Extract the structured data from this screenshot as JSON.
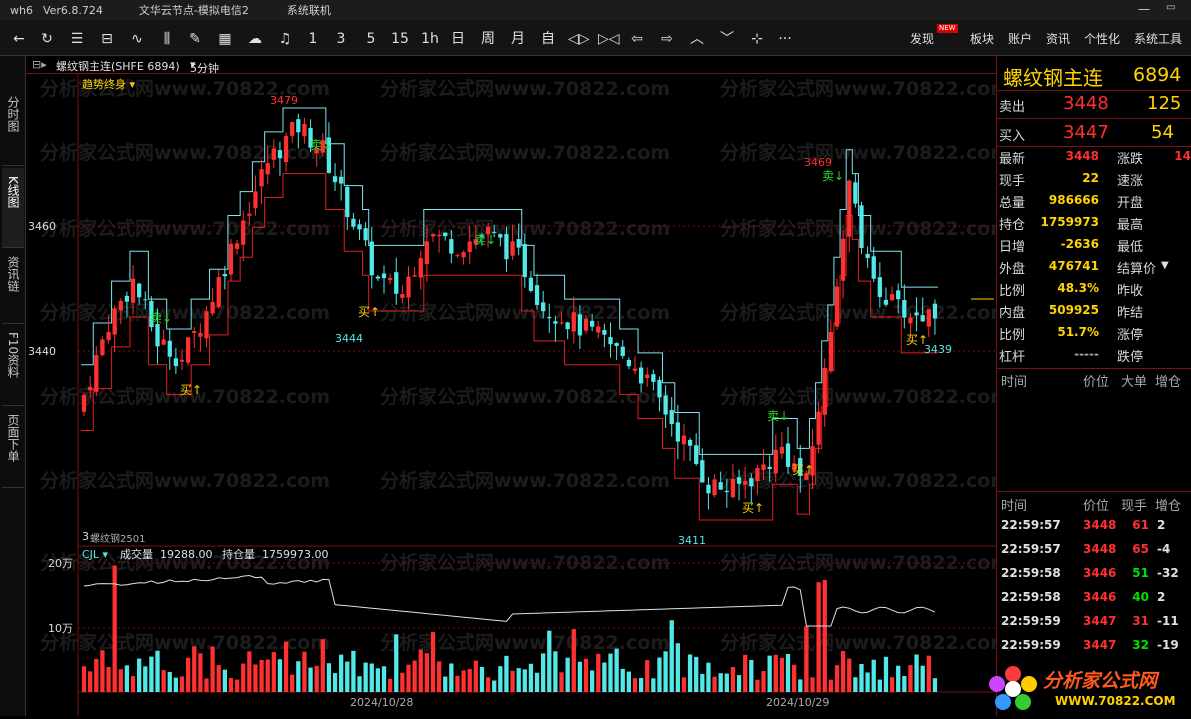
{
  "titlebar": {
    "app": "wh6",
    "version": "Ver6.8.724",
    "node": "文华云节点-模拟电信2",
    "status": "系统联机"
  },
  "toolbar": {
    "periods": [
      "1",
      "3",
      "5",
      "15",
      "1h",
      "日",
      "周",
      "月",
      "自"
    ],
    "menus": [
      "发现",
      "板块",
      "账户",
      "资讯",
      "个性化",
      "系统工具"
    ],
    "new_badge": "NEW",
    "more": "···"
  },
  "left_tabs": [
    "分时图",
    "K线图",
    "资讯链",
    "F10资料",
    "页面下单"
  ],
  "chart_header": {
    "contract": "螺纹钢主连(SHFE 6894)",
    "period": "5分钟",
    "indicator": "趋势终身"
  },
  "chart_labels": {
    "hi1": "3479",
    "lo1": "3444",
    "hi2": "3469",
    "lo2": "3411",
    "last": "3439",
    "sell": "卖↓",
    "buy": "买↑",
    "contract_bottom": "螺纹钢2501",
    "bottom_prefix": "3",
    "ytick_3460": "3460",
    "ytick_3440": "3440"
  },
  "volume_panel": {
    "indicator": "CJL",
    "volume_label": "成交量",
    "volume": "19288.00",
    "oi_label": "持仓量",
    "oi": "1759973.00",
    "ytick_20w": "20万",
    "ytick_10w": "10万"
  },
  "x_dates": [
    "2024/10/28",
    "2024/10/29"
  ],
  "watermark": "分析家公式网www.70822.com",
  "quote": {
    "name": "螺纹钢主连",
    "code": "6894",
    "ask_label": "卖出",
    "ask_price": "3448",
    "ask_vol": "125",
    "bid_label": "买入",
    "bid_price": "3447",
    "bid_vol": "54",
    "rows": [
      {
        "l1": "最新",
        "v1": "3448",
        "c1": "red",
        "l2": "涨跌",
        "v2": "14",
        "c2": "red"
      },
      {
        "l1": "现手",
        "v1": "22",
        "c1": "yel",
        "l2": "速涨",
        "v2": "",
        "c2": "white"
      },
      {
        "l1": "总量",
        "v1": "986666",
        "c1": "yel",
        "l2": "开盘",
        "v2": "",
        "c2": "white"
      },
      {
        "l1": "持仓",
        "v1": "1759973",
        "c1": "yel",
        "l2": "最高",
        "v2": "",
        "c2": "white"
      },
      {
        "l1": "日增",
        "v1": "-2636",
        "c1": "yel",
        "l2": "最低",
        "v2": "",
        "c2": "white"
      },
      {
        "l1": "外盘",
        "v1": "476741",
        "c1": "yel",
        "l2": "结算价",
        "v2": "",
        "c2": "white"
      },
      {
        "l1": "比例",
        "v1": "48.3%",
        "c1": "yel",
        "l2": "昨收",
        "v2": "",
        "c2": "white"
      },
      {
        "l1": "内盘",
        "v1": "509925",
        "c1": "yel",
        "l2": "昨结",
        "v2": "",
        "c2": "white"
      },
      {
        "l1": "比例",
        "v1": "51.7%",
        "c1": "yel",
        "l2": "涨停",
        "v2": "",
        "c2": "white"
      },
      {
        "l1": "杠杆",
        "v1": "-----",
        "c1": "gray",
        "l2": "跌停",
        "v2": "",
        "c2": "white"
      }
    ],
    "big_header": [
      "时间",
      "价位",
      "大单",
      "增仓"
    ],
    "tick_header": [
      "时间",
      "价位",
      "现手",
      "增仓"
    ],
    "ticks": [
      {
        "time": "22:59:57",
        "price": "3448",
        "vol": "61",
        "vcolor": "red",
        "oi": "2"
      },
      {
        "time": "22:59:57",
        "price": "3448",
        "vol": "65",
        "vcolor": "red",
        "oi": "-4"
      },
      {
        "time": "22:59:58",
        "price": "3446",
        "vol": "51",
        "vcolor": "green",
        "oi": "-32"
      },
      {
        "time": "22:59:58",
        "price": "3446",
        "vol": "40",
        "vcolor": "green",
        "oi": "2"
      },
      {
        "time": "22:59:59",
        "price": "3447",
        "vol": "31",
        "vcolor": "red",
        "oi": "-11"
      },
      {
        "time": "22:59:59",
        "price": "3447",
        "vol": "32",
        "vcolor": "green",
        "oi": "-19"
      }
    ]
  },
  "logo": {
    "text": "分析家公式网",
    "url": "WWW.70822.COM"
  },
  "colors": {
    "up": "#ff3030",
    "down": "#52e8e8",
    "grid": "#7a1010",
    "price": "#ffd400"
  }
}
